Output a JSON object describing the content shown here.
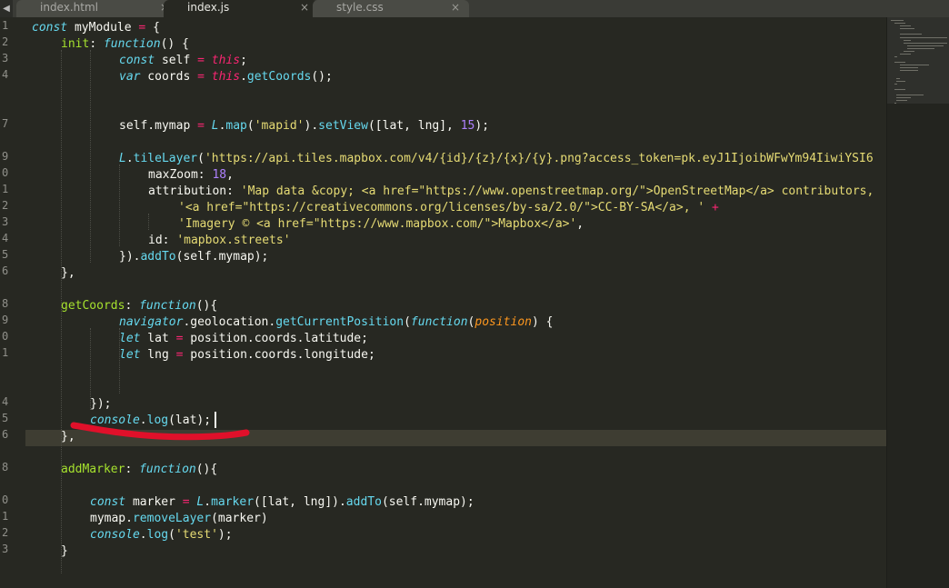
{
  "tabs": [
    {
      "label": "index.html",
      "close": "×",
      "active": false
    },
    {
      "label": "index.js",
      "close": "×",
      "active": true
    },
    {
      "label": "style.css",
      "close": "×",
      "active": false
    }
  ],
  "tab_scroll_arrow": "◀",
  "line_numbers": [
    "1",
    "2",
    "3",
    "4",
    "",
    "",
    "7",
    "",
    "9",
    "0",
    "1",
    "2",
    "3",
    "4",
    "5",
    "6",
    "",
    "8",
    "9",
    "0",
    "1",
    "",
    "",
    "4",
    "5",
    "6",
    "",
    "8",
    "",
    "0",
    "1",
    "2",
    "3",
    ""
  ],
  "code_lines": {
    "l1": [
      "const",
      " myModule ",
      "=",
      " {"
    ],
    "l2": [
      "init",
      ": ",
      "function",
      "() {"
    ],
    "l3": [
      "const",
      " self ",
      "=",
      " ",
      "this",
      ";"
    ],
    "l4": [
      "var",
      " coords ",
      "=",
      " ",
      "this",
      ".",
      "getCoords",
      "();"
    ],
    "l7": [
      "self.mymap ",
      "=",
      " ",
      "L",
      ".",
      "map",
      "(",
      "'mapid'",
      ").",
      "setView",
      "([lat, lng], ",
      "15",
      ");"
    ],
    "l9": [
      "L",
      ".",
      "tileLayer",
      "(",
      "'https://api.tiles.mapbox.com/v4/{id}/{z}/{x}/{y}.png?access_token=pk.eyJ1IjoibWFwYm94IiwiYSI6"
    ],
    "l10": [
      "maxZoom: ",
      "18",
      ","
    ],
    "l11": [
      "attribution: ",
      "'Map data &copy; <a href=\"https://www.openstreetmap.org/\">OpenStreetMap</a> contributors, "
    ],
    "l12": [
      "'<a href=\"https://creativecommons.org/licenses/by-sa/2.0/\">CC-BY-SA</a>, '",
      " ",
      "+"
    ],
    "l13": [
      "'Imagery © <a href=\"https://www.mapbox.com/\">Mapbox</a>'",
      ","
    ],
    "l14": [
      "id: ",
      "'mapbox.streets'"
    ],
    "l15": [
      "}).",
      "addTo",
      "(self.mymap);"
    ],
    "l16": [
      "},"
    ],
    "l18": [
      "getCoords",
      ": ",
      "function",
      "(){"
    ],
    "l19": [
      "navigator",
      ".geolocation.",
      "getCurrentPosition",
      "(",
      "function",
      "(",
      "position",
      ") {"
    ],
    "l20": [
      "let",
      " lat ",
      "=",
      " position.coords.latitude;"
    ],
    "l21": [
      "let",
      " lng ",
      "=",
      " position.coords.longitude;"
    ],
    "l24": [
      "});"
    ],
    "l25": [
      "console",
      ".",
      "log",
      "(lat);"
    ],
    "l26": [
      "},"
    ],
    "l28": [
      "addMarker",
      ": ",
      "function",
      "(){"
    ],
    "l30": [
      "const",
      " marker ",
      "=",
      " ",
      "L",
      ".",
      "marker",
      "([lat, lng]).",
      "addTo",
      "(self.mymap);"
    ],
    "l31": [
      "mymap.",
      "removeLayer",
      "(marker)"
    ],
    "l32": [
      "console",
      ".",
      "log",
      "(",
      "'test'",
      ");"
    ],
    "l33": [
      "}"
    ]
  },
  "colors": {
    "background": "#272822",
    "keyword": "#66d9ef",
    "function_name": "#a6e22e",
    "string": "#e6db74",
    "number": "#ae81ff",
    "operator": "#f92672",
    "parameter": "#fd971f",
    "annotation": "#e0102a"
  }
}
